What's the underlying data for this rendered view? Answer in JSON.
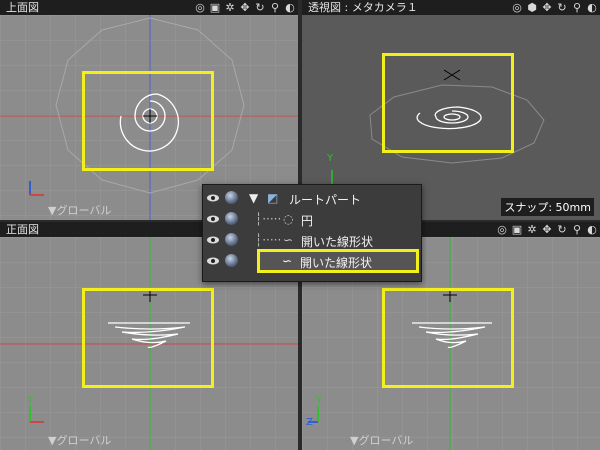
{
  "viewports": {
    "top": {
      "title": "上面図",
      "footer": "▼グローバル"
    },
    "persp": {
      "title": "透視図 : メタカメラ１",
      "snap": "スナップ: 50mm"
    },
    "front": {
      "title": "正面図",
      "footer": "▼グローバル"
    },
    "side": {
      "title": "",
      "footer": "▼グローバル"
    }
  },
  "axes": {
    "y": "Y",
    "x": "X",
    "z": "Z"
  },
  "outliner": {
    "root": "ルートパート",
    "items": [
      {
        "label": "円"
      },
      {
        "label": "開いた線形状"
      },
      {
        "label": "開いた線形状",
        "selected": true
      }
    ]
  },
  "colors": {
    "highlight": "#f2ef1a",
    "grid_bg": "#8c8c8c",
    "persp_bg": "#5a5a5a"
  }
}
